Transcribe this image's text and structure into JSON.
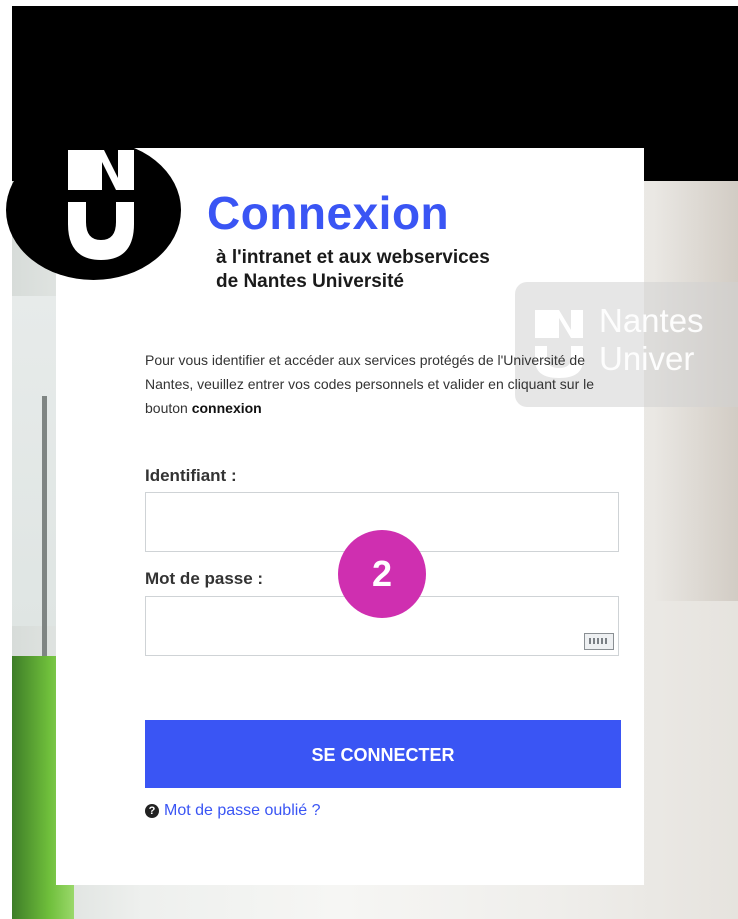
{
  "header": {
    "title": "Connexion",
    "subtitle_line1": "à l'intranet et aux webservices",
    "subtitle_line2": "de Nantes Université"
  },
  "watermark": {
    "line1": "Nantes",
    "line2": "Univer"
  },
  "intro": {
    "text_before_bold": "Pour vous identifier et accéder aux services protégés de l'Université de Nantes, veuillez entrer vos codes personnels et valider en cliquant sur le bouton ",
    "bold_word": "connexion"
  },
  "form": {
    "username_label": "Identifiant :",
    "username_value": "",
    "password_label": "Mot de passe :",
    "password_value": "",
    "submit_label": "SE CONNECTER",
    "forgot_label": "Mot de passe oublié ?"
  },
  "overlay": {
    "step_number": "2"
  },
  "icons": {
    "logo": "nantes-universite-logo-icon",
    "keyboard": "virtual-keyboard-icon",
    "help": "question-circle-icon"
  },
  "colors": {
    "accent": "#3a55f4",
    "badge": "#cf2fb0"
  }
}
